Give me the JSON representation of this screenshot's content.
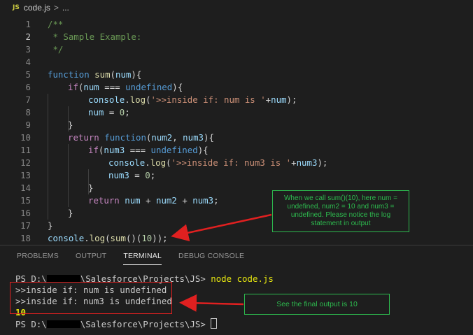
{
  "breadcrumb": {
    "file_badge": "JS",
    "file_name": "code.js",
    "separator": ">",
    "ellipsis": "..."
  },
  "editor": {
    "active_line": 2,
    "lines": [
      {
        "n": "1"
      },
      {
        "n": "2"
      },
      {
        "n": "3"
      },
      {
        "n": "4"
      },
      {
        "n": "5"
      },
      {
        "n": "6"
      },
      {
        "n": "7"
      },
      {
        "n": "8"
      },
      {
        "n": "9"
      },
      {
        "n": "10"
      },
      {
        "n": "11"
      },
      {
        "n": "12"
      },
      {
        "n": "13"
      },
      {
        "n": "14"
      },
      {
        "n": "15"
      },
      {
        "n": "16"
      },
      {
        "n": "17"
      },
      {
        "n": "18"
      }
    ],
    "tokens": {
      "l1_cmt": "/**",
      "l2_cmt": " * Sample Example:",
      "l3_cmt": " */",
      "l5_kw": "function",
      "l5_fn": "sum",
      "l5_a": "(",
      "l5_var": "num",
      "l5_b": "){",
      "l6_ctl": "if",
      "l6_a": "(",
      "l6_var": "num",
      "l6_b": " === ",
      "l6_kw": "undefined",
      "l6_c": "){",
      "l7_obj": "console",
      "l7_a": ".",
      "l7_fn": "log",
      "l7_b": "(",
      "l7_str": "'>>inside if: num is '",
      "l7_c": "+",
      "l7_var": "num",
      "l7_d": ");",
      "l8_var": "num",
      "l8_a": " = ",
      "l8_num": "0",
      "l8_b": ";",
      "l9": "}",
      "l10_ctl": "return",
      "l10_kw": "function",
      "l10_a": "(",
      "l10_v1": "num2",
      "l10_b": ", ",
      "l10_v2": "num3",
      "l10_c": "){",
      "l11_ctl": "if",
      "l11_a": "(",
      "l11_var": "num3",
      "l11_b": " === ",
      "l11_kw": "undefined",
      "l11_c": "){",
      "l12_obj": "console",
      "l12_a": ".",
      "l12_fn": "log",
      "l12_b": "(",
      "l12_str": "'>>inside if: num3 is '",
      "l12_c": "+",
      "l12_var": "num3",
      "l12_d": ");",
      "l13_var": "num3",
      "l13_a": " = ",
      "l13_num": "0",
      "l13_b": ";",
      "l14": "}",
      "l15_ctl": "return",
      "l15_v1": "num",
      "l15_a": " + ",
      "l15_v2": "num2",
      "l15_b": " + ",
      "l15_v3": "num3",
      "l15_c": ";",
      "l16": "}",
      "l17": "}",
      "l18_obj": "console",
      "l18_a": ".",
      "l18_fn": "log",
      "l18_b": "(",
      "l18_fn2": "sum",
      "l18_c": "()(",
      "l18_num": "10",
      "l18_d": "));"
    }
  },
  "panel": {
    "tabs": [
      "PROBLEMS",
      "OUTPUT",
      "TERMINAL",
      "DEBUG CONSOLE"
    ],
    "active_tab": "TERMINAL",
    "terminal": {
      "prompt_prefix": "PS D:\\",
      "prompt_path": "\\Salesforce\\Projects\\JS> ",
      "command": "node code.js",
      "output_1": ">>inside if: num is undefined",
      "output_2": ">>inside if: num3 is undefined",
      "output_3": "10"
    }
  },
  "annotations": {
    "callout_1": "When we call sum()(10), here num = undefined, num2 = 10 and num3 = undefined. Please notice the log statement in output",
    "callout_2": "See the final output is 10",
    "callout_color": "#2dba4e",
    "arrow_color": "#e02020"
  }
}
